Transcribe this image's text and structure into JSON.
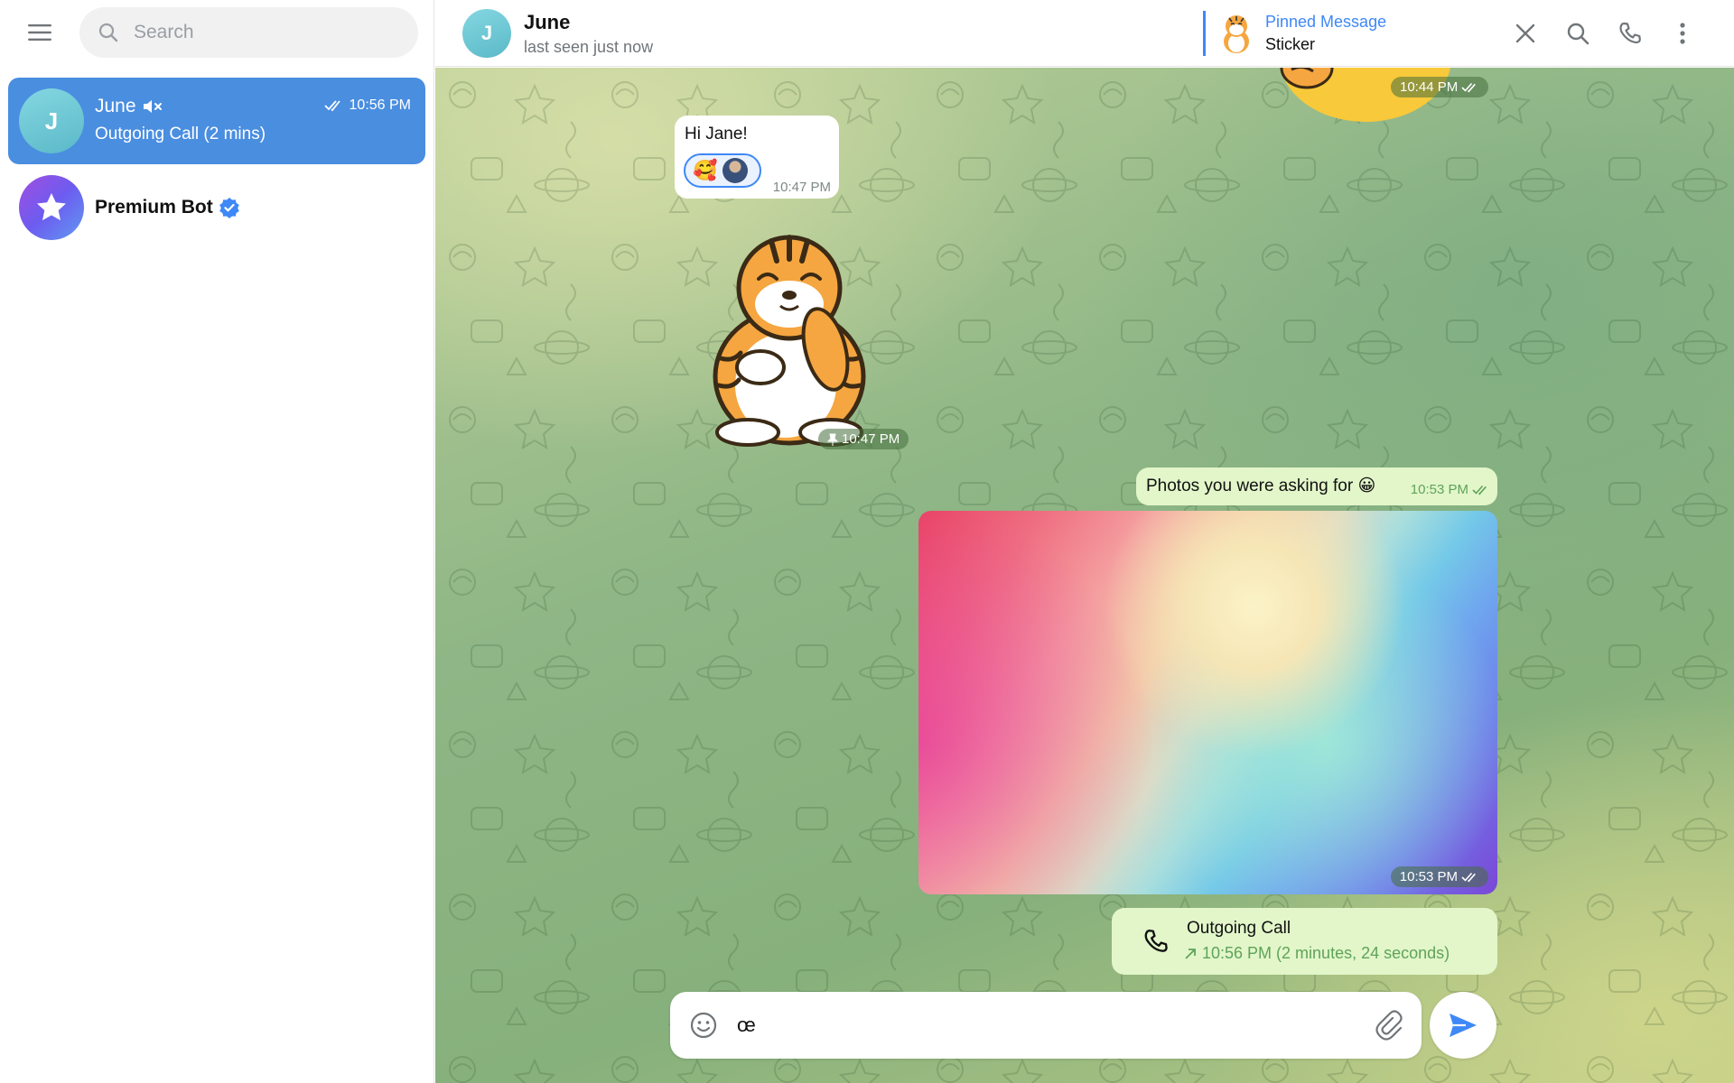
{
  "sidebar": {
    "search": {
      "placeholder": "Search",
      "value": ""
    },
    "chats": [
      {
        "name": "June",
        "avatar_letter": "J",
        "preview": "Outgoing Call (2 mins)",
        "time": "10:56 PM",
        "muted": true,
        "read": true,
        "active": true
      },
      {
        "name": "Premium Bot",
        "verified": true,
        "active": false
      }
    ]
  },
  "header": {
    "avatar_letter": "J",
    "name": "June",
    "status": "last seen just now",
    "pinned": {
      "title": "Pinned Message",
      "text": "Sticker"
    }
  },
  "messages": {
    "top_sticker_time": "10:44 PM",
    "hi": {
      "text": "Hi Jane!",
      "reaction_emoji": "🥰",
      "time": "10:47 PM"
    },
    "tiger_sticker_time": "10:47 PM",
    "photos": {
      "text": "Photos you were asking for 😀",
      "time": "10:53 PM"
    },
    "photo_time": "10:53 PM",
    "call": {
      "title": "Outgoing Call",
      "detail": "10:56 PM (2 minutes, 24 seconds)"
    }
  },
  "composer": {
    "value": "œ",
    "placeholder": ""
  },
  "icons": {
    "menu": "hamburger-menu-icon",
    "search": "search-icon",
    "close": "close-icon",
    "call": "phone-icon",
    "more": "more-vertical-icon",
    "emoji": "smile-icon",
    "attach": "paperclip-icon",
    "send": "send-icon"
  },
  "colors": {
    "accent": "#3e88f7",
    "active_chat": "#4a8ee0",
    "outgoing_bubble": "#e2f6c9",
    "outgoing_time": "#5fa35a"
  }
}
